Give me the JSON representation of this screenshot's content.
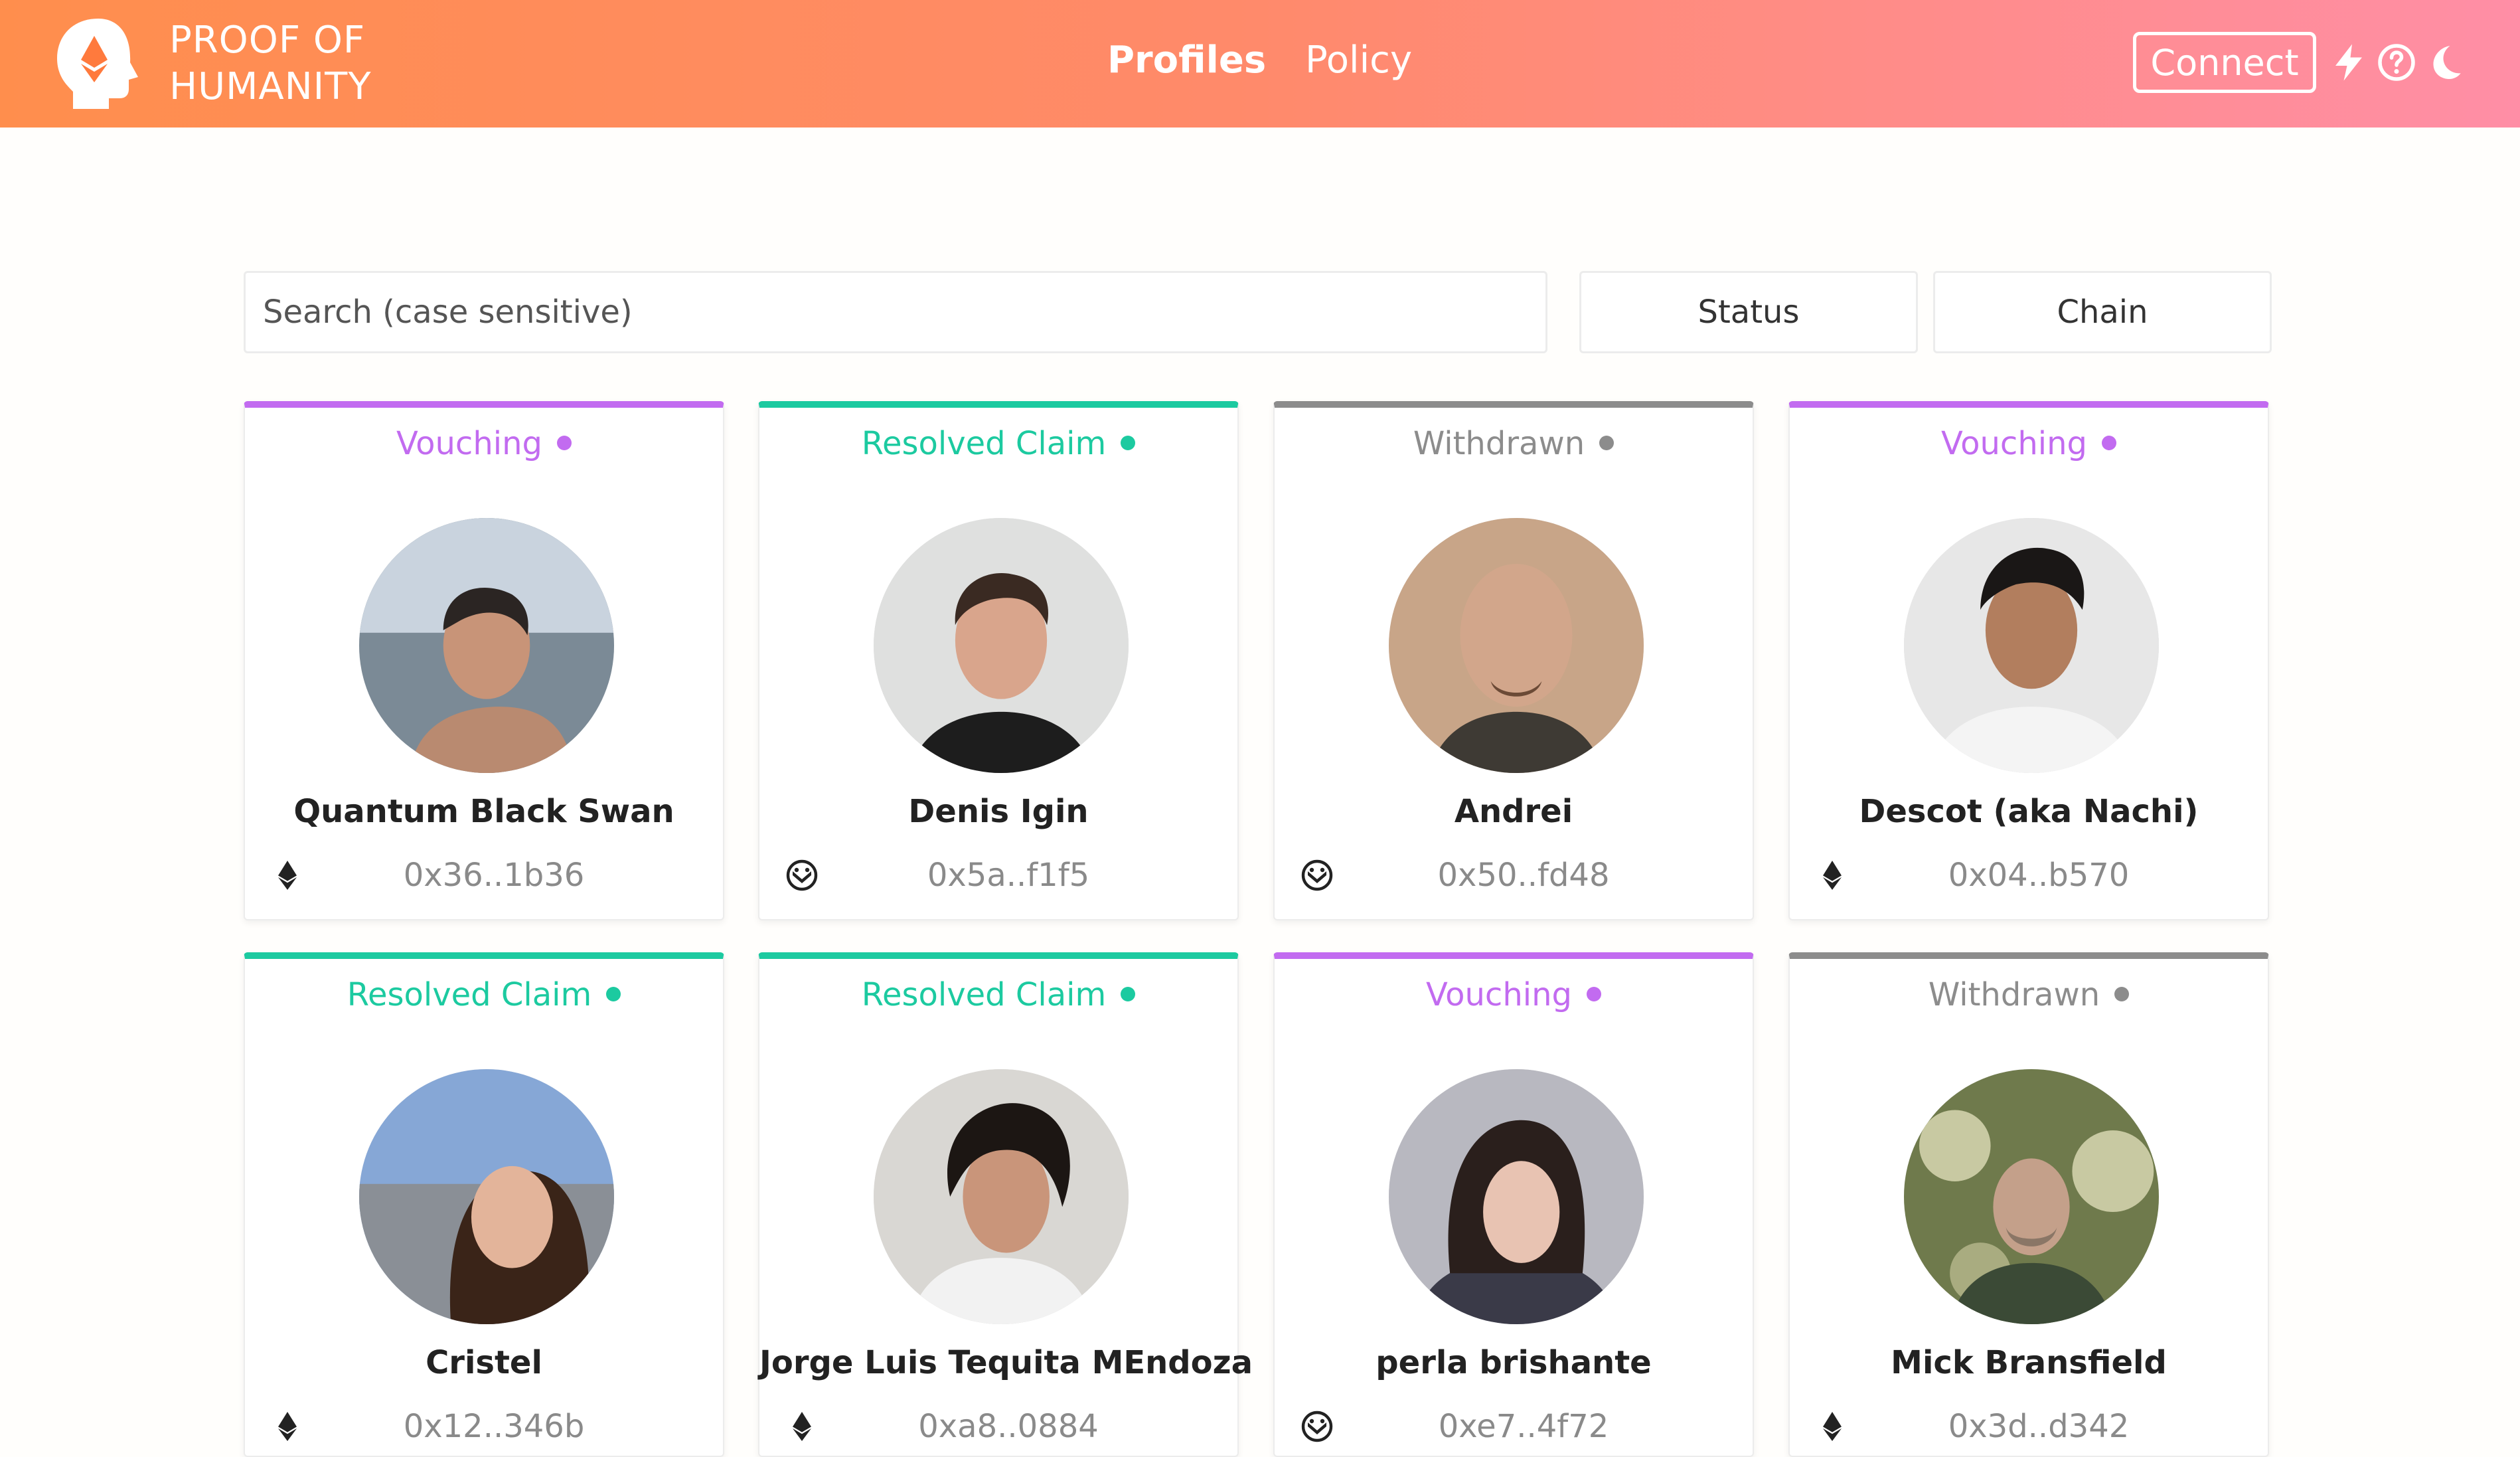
{
  "header": {
    "brand_line1": "PROOF OF",
    "brand_line2": "HUMANITY",
    "nav": {
      "profiles": "Profiles",
      "policy": "Policy"
    },
    "connect_label": "Connect",
    "icons": [
      "bolt-icon",
      "help-icon",
      "moon-icon"
    ]
  },
  "filters": {
    "search_placeholder": "Search (case sensitive)",
    "search_value": "",
    "status_label": "Status",
    "chain_label": "Chain"
  },
  "colors": {
    "header_gradient_start": "#ff8e4d",
    "header_gradient_end": "#ff8ea6",
    "vouching": "#c26bf0",
    "resolved": "#1ccaa0",
    "withdrawn": "#8c8c8c"
  },
  "profiles": [
    {
      "status": "Vouching",
      "name": "Quantum Black Swan",
      "address": "0x36..1b36",
      "chain_icon": "ethereum-icon"
    },
    {
      "status": "Resolved Claim",
      "name": "Denis Igin",
      "address": "0x5a..f1f5",
      "chain_icon": "gnosis-icon"
    },
    {
      "status": "Withdrawn",
      "name": "Andrei",
      "address": "0x50..fd48",
      "chain_icon": "gnosis-icon"
    },
    {
      "status": "Vouching",
      "name": "Descot (aka Nachi)",
      "address": "0x04..b570",
      "chain_icon": "ethereum-icon"
    },
    {
      "status": "Resolved Claim",
      "name": "Cristel",
      "address": "0x12..346b",
      "chain_icon": "ethereum-icon"
    },
    {
      "status": "Resolved Claim",
      "name": "Jorge Luis Tequita MEndoza",
      "address": "0xa8..0884",
      "chain_icon": "ethereum-icon"
    },
    {
      "status": "Vouching",
      "name": "perla brishante",
      "address": "0xe7..4f72",
      "chain_icon": "gnosis-icon"
    },
    {
      "status": "Withdrawn",
      "name": "Mick Bransfield",
      "address": "0x3d..d342",
      "chain_icon": "ethereum-icon"
    }
  ]
}
